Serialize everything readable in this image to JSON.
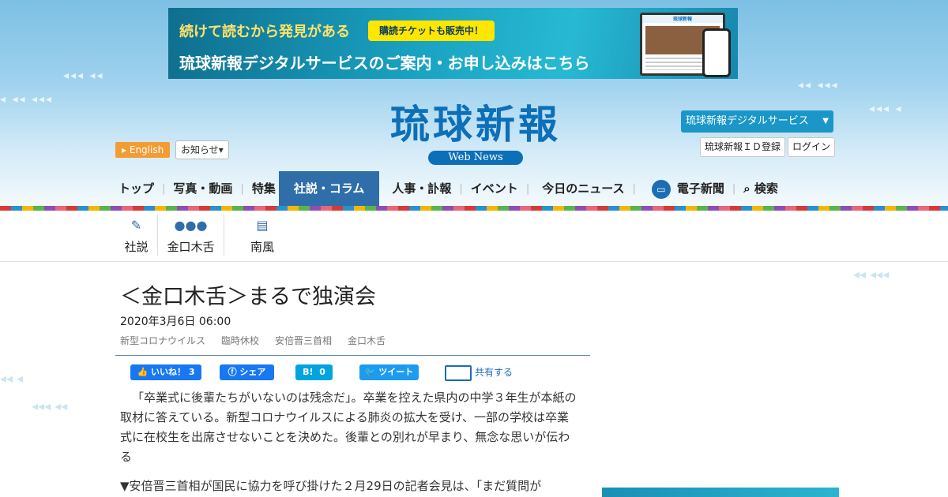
{
  "banner": {
    "line1": "続けて読むから発見がある",
    "badge": "購読チケットも販売中！",
    "line2": "琉球新報デジタルサービスのご案内・お申し込みはこちら",
    "pc_title": "琉球新報"
  },
  "header": {
    "english_label": "English",
    "notice_label": "お知らせ",
    "logo_text": "琉球新報",
    "logo_sub": "Web News",
    "digital_service_label": "琉球新報デジタルサービス",
    "id_register_label": "琉球新報ＩＤ登録",
    "login_label": "ログイン"
  },
  "nav": {
    "items": [
      {
        "label": "トップ"
      },
      {
        "label": "写真・動画"
      },
      {
        "label": "特集"
      },
      {
        "label": "社説・コラム"
      },
      {
        "label": "人事・訃報"
      },
      {
        "label": "イベント"
      },
      {
        "label": "今日のニュース"
      },
      {
        "label": "電子新聞"
      },
      {
        "label": "検索"
      }
    ]
  },
  "subnav": {
    "items": [
      {
        "label": "社説"
      },
      {
        "label": "金口木舌"
      },
      {
        "label": "南風"
      }
    ]
  },
  "article": {
    "title": "＜金口木舌＞まるで独演会",
    "date": "2020年3月6日 06:00",
    "tags": [
      "新型コロナウイルス",
      "臨時休校",
      "安倍晋三首相",
      "金口木舌"
    ],
    "share": {
      "like_label": "いいね！",
      "like_count": "3",
      "share_label": "シェア",
      "hatena_label": "B!",
      "hatena_count": "0",
      "tweet_label": "ツイート",
      "mail_label": "共有する"
    },
    "paragraphs": [
      "「卒業式に後輩たちがいないのは残念だ」。卒業を控えた県内の中学３年生が本紙の取材に答えている。新型コロナウイルスによる肺炎の拡大を受け、一部の学校は卒業式に在校生を出席させないことを決めた。後輩との別れが早まり、無念な思いが伝わる",
      "▼安倍晋三首相が国民に協力を呼び掛けた２月29日の記者会見は、「まだ質問が"
    ]
  },
  "colors": {
    "brand_blue": "#0d6fb8",
    "nav_active": "#2f6ea8",
    "english_orange": "#f39c33",
    "facebook": "#1877f2",
    "twitter": "#1d9bf0",
    "hatena": "#00a4de"
  }
}
